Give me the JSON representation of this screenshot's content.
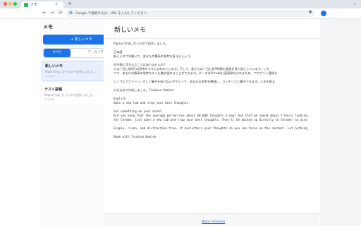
{
  "tab": {
    "title": "メモ",
    "close": "×",
    "new_tab": "+"
  },
  "toolbar": {
    "back": "←",
    "forward": "→",
    "reload": "⟳",
    "search_placeholder": "Google で検索するか、URL を入力してください",
    "bookmark": "★"
  },
  "sidebar": {
    "title": "メモ",
    "new_memo_label": "+ 新しいメモ",
    "filters": [
      "すべて",
      "アーカイブ"
    ],
    "memos": [
      {
        "title": "新しいメモ",
        "snippet": "Papierがほしかったので自作しました。",
        "time": "たった今"
      },
      {
        "title": "テスト投稿",
        "snippet": "Papierがほしかったので自作しました。",
        "time": "たった今"
      }
    ]
  },
  "editor": {
    "title": "新しいメモ",
    "lines": [
      "Papierがほしかったので自作しました。",
      "",
      "日本語",
      "新しいタブを開いて、あなたの最高の思考を捉えましょう。",
      "",
      "何か頭に浮かんだことはありませんか？",
      "人は一日に約6万の思考をすると言われています。そして、私たちは一日に約7時間も画面を見て過ごしています。これ",
      "けで、あなたの最高の思考をすぐに書き留めることができます。データはChromeに直接保存されるため、アカウント登録も",
      "",
      "シンプルでクリーン、そして集中を妨げないデザインで、あなたの思考を整理し、コンテンツに集中できます。メモを取る",
      "",
      "心を込めて作成しました。Tsukasa Komine",
      "",
      "English",
      "Open a new tab and trap your best thoughts.",
      "",
      "Got something on your mind?",
      "Did you know that the average person has about 60,000 thoughts a day? And that we spend about 7 hours looking",
      "for Chrome, just open a new tab and trap your best thoughts. They'll be backed up directly to Chrome! no acco",
      "",
      "Simple, clean, and distraction-free, it declutters your thoughts so you can focus on the content. Let nothing",
      "",
      "Made with Tsukasa Komine"
    ],
    "footer_link": "Memo Extension"
  }
}
